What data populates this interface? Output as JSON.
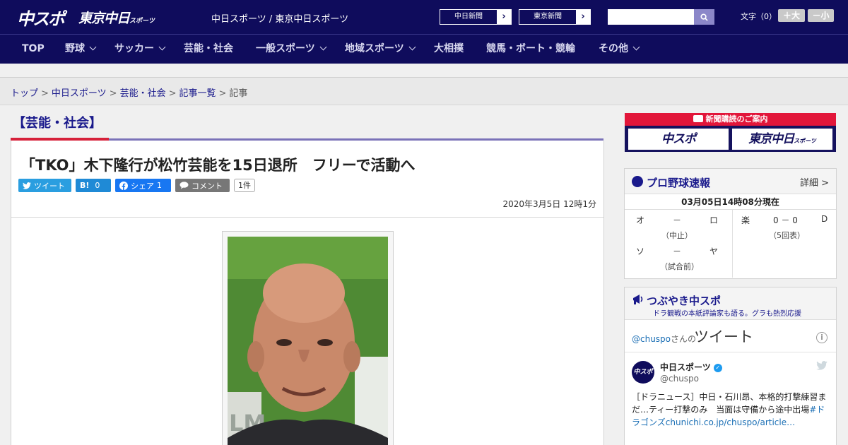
{
  "header": {
    "logo_chuspo": "中スポ",
    "logo_tokyo": "東京中日",
    "logo_tokyo_small": "スポーツ",
    "site_names": "中日スポーツ / 東京中日スポーツ",
    "paper_chunichi": "中日新聞",
    "paper_tokyo": "東京新聞",
    "search_placeholder": "",
    "fontsize_label": "文字（0）",
    "fontsize_up": "＋大",
    "fontsize_down": "－小"
  },
  "nav": {
    "items": [
      {
        "label": "TOP",
        "has_menu": false
      },
      {
        "label": "野球",
        "has_menu": true
      },
      {
        "label": "サッカー",
        "has_menu": true
      },
      {
        "label": "芸能・社会",
        "has_menu": false
      },
      {
        "label": "一般スポーツ",
        "has_menu": true
      },
      {
        "label": "地域スポーツ",
        "has_menu": true
      },
      {
        "label": "大相撲",
        "has_menu": false
      },
      {
        "label": "競馬・ボート・競輪",
        "has_menu": false
      },
      {
        "label": "その他",
        "has_menu": true
      }
    ]
  },
  "breadcrumb": {
    "items": [
      "トップ",
      "中日スポーツ",
      "芸能・社会",
      "記事一覧"
    ],
    "current": "記事",
    "separator": ">"
  },
  "article": {
    "category": "【芸能・社会】",
    "title": "「TKO」木下隆行が松竹芸能を15日退所　フリーで活動へ",
    "date": "2020年3月5日 12時1分",
    "share": {
      "tweet_label": "ツイート",
      "hatena_label": "B!",
      "hatena_count": "0",
      "facebook_label": "シェア",
      "facebook_count": "1",
      "comment_label": "コメント",
      "comment_count": "1件"
    }
  },
  "sidebar": {
    "subscribe": {
      "heading": "新聞購読のご案内",
      "logo_chuspo": "中スポ",
      "logo_tokyo": "東京中日",
      "logo_tokyo_small": "スポーツ"
    },
    "baseball": {
      "title": "プロ野球速報",
      "more": "詳細 >",
      "time": "03月05日14時08分現在",
      "games": [
        {
          "home": "オ",
          "score": "－",
          "away": "ロ",
          "status": "（中止）"
        },
        {
          "home": "楽",
          "score": "0 － 0",
          "away": "D",
          "status": "（5回表）"
        },
        {
          "home": "ソ",
          "score": "－",
          "away": "ヤ",
          "status": "（試合前）"
        }
      ]
    },
    "tweets": {
      "title": "つぶやき中スポ",
      "subtitle": "ドラ観戦の本紙評論家も語る。グラも熱烈応援",
      "handle": "@chuspo",
      "handle_suffix": "さんの",
      "heading": "ツイート",
      "info": "i",
      "avatar_text": "中スポ",
      "name": "中日スポーツ",
      "user": "@chuspo",
      "body_text": "［ドラニュース］中日・石川昂、本格的打撃練習まだ…ティー打撃のみ　当面は守備から途中出場",
      "body_hashtag": "#ドラゴンズ",
      "body_link": "chunichi.co.jp/chuspo/article…"
    }
  }
}
